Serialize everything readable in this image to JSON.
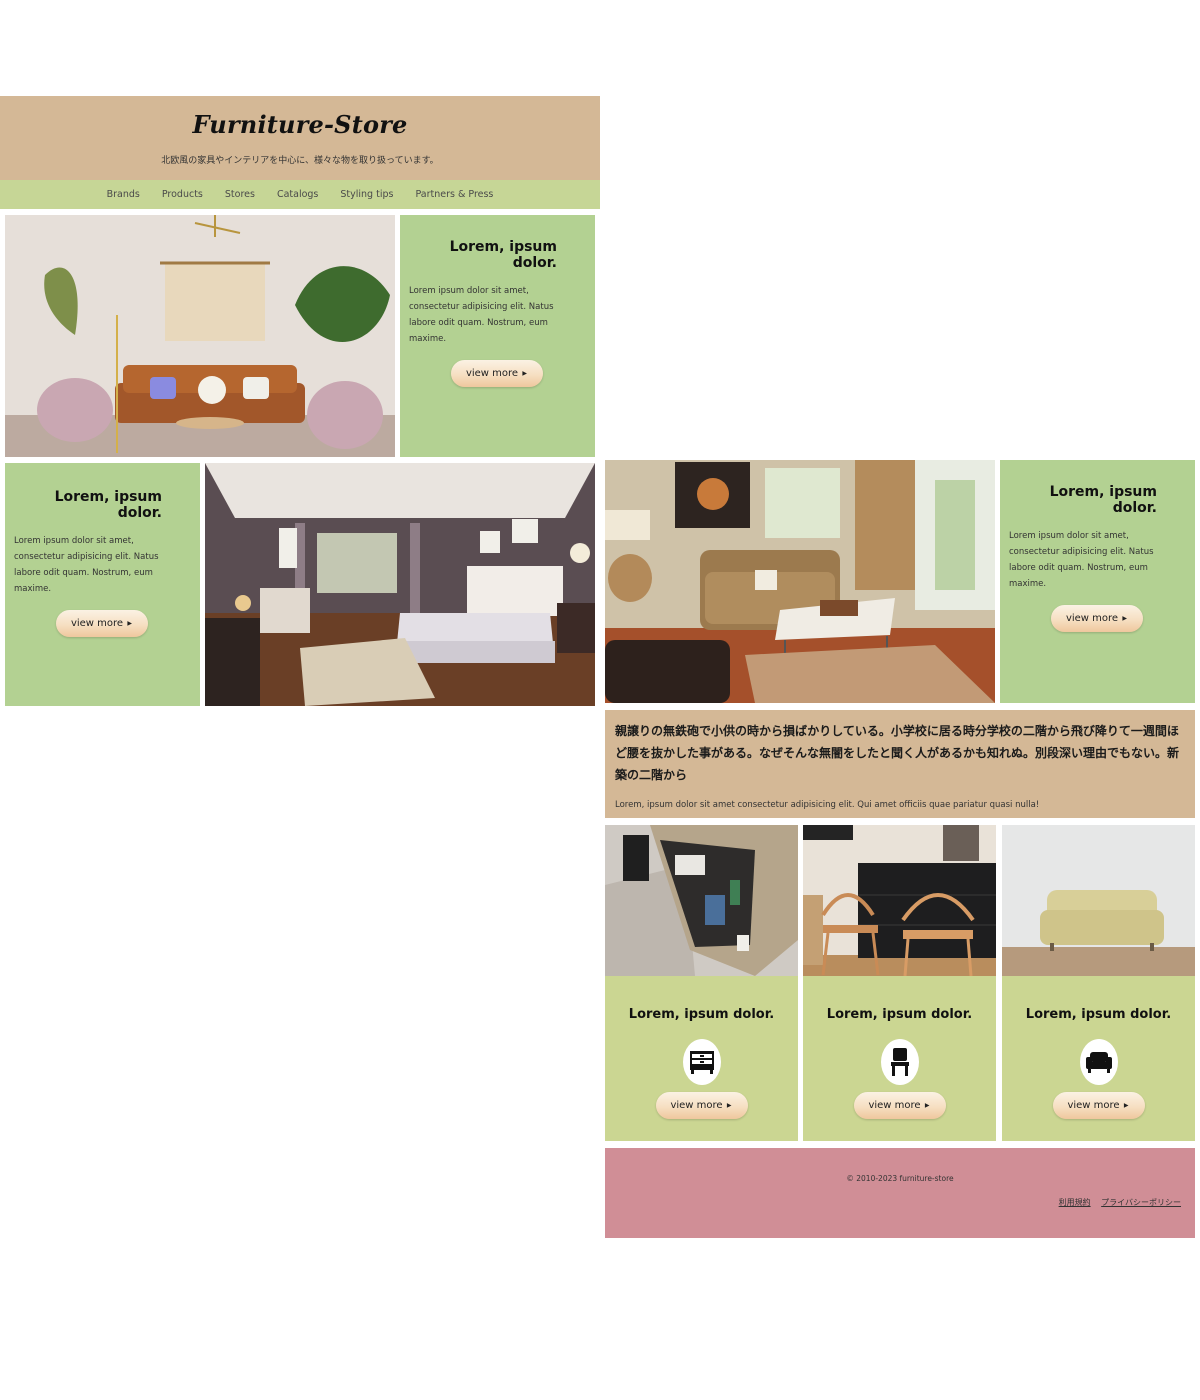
{
  "header": {
    "title": "Furniture-Store",
    "tagline": "北欧風の家具やインテリアを中心に、様々な物を取り扱っています。"
  },
  "nav": {
    "items": [
      "Brands",
      "Products",
      "Stores",
      "Catalogs",
      "Styling tips",
      "Partners & Press"
    ]
  },
  "features": [
    {
      "heading": "Lorem, ipsum dolor.",
      "text": "Lorem ipsum dolor sit amet, consectetur adipisicing elit. Natus labore odit quam. Nostrum, eum maxime.",
      "button": "view more",
      "image": "living-room-photo"
    },
    {
      "heading": "Lorem, ipsum dolor.",
      "text": "Lorem ipsum dolor sit amet, consectetur adipisicing elit. Natus labore odit quam. Nostrum, eum maxime.",
      "button": "view more",
      "image": "bedroom-photo"
    },
    {
      "heading": "Lorem, ipsum dolor.",
      "text": "Lorem ipsum dolor sit amet, consectetur adipisicing elit. Natus labore odit quam. Nostrum, eum maxime.",
      "button": "view more",
      "image": "lounge-photo"
    }
  ],
  "text_block": {
    "heading": "親譲りの無鉄砲で小供の時から損ばかりしている。小学校に居る時分学校の二階から飛び降りて一週間ほど腰を抜かした事がある。なぜそんな無闇をしたと聞く人があるかも知れぬ。別段深い理由でもない。新築の二階から",
    "text": "Lorem, ipsum dolor sit amet consectetur adipisicing elit. Qui amet officiis quae pariatur quasi nulla!"
  },
  "products": [
    {
      "heading": "Lorem, ipsum dolor.",
      "icon": "dresser-icon",
      "button": "view more",
      "image": "drawer-photo"
    },
    {
      "heading": "Lorem, ipsum dolor.",
      "icon": "chair-icon",
      "button": "view more",
      "image": "chairs-photo"
    },
    {
      "heading": "Lorem, ipsum dolor.",
      "icon": "sofa-icon",
      "button": "view more",
      "image": "sofa-photo"
    }
  ],
  "footer": {
    "copyright": "© 2010-2023 furniture-store",
    "links": [
      "利用規約",
      "プライバシーポリシー"
    ]
  },
  "colors": {
    "header_bg": "#d4b896",
    "nav_bg": "#c6d696",
    "panel_bg": "#b3d192",
    "card_bg": "#cbd692",
    "footer_bg": "#d08e96"
  }
}
